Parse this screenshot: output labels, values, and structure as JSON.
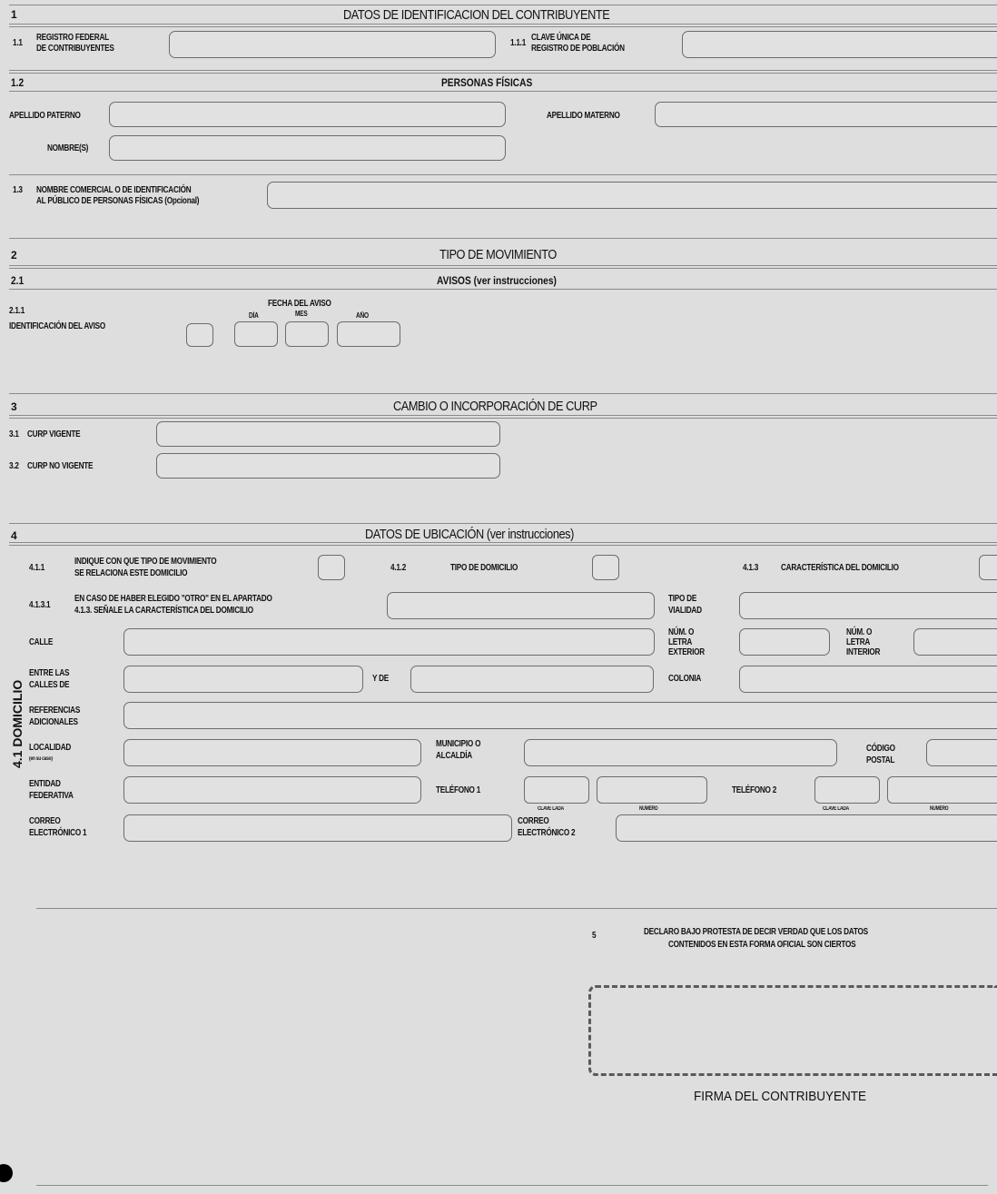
{
  "section1": {
    "num": "1",
    "title": "DATOS DE IDENTIFICACION DEL CONTRIBUYENTE",
    "f11_num": "1.1",
    "f11_label1": "REGISTRO FEDERAL",
    "f11_label2": "DE CONTRIBUYENTES",
    "f111_num": "1.1.1",
    "f111_label1": "CLAVE ÚNICA DE",
    "f111_label2": "REGISTRO DE POBLACIÓN"
  },
  "section12": {
    "num": "1.2",
    "title": "PERSONAS FÍSICAS",
    "apellido_paterno": "APELLIDO PATERNO",
    "apellido_materno": "APELLIDO MATERNO",
    "nombres": "NOMBRE(S)"
  },
  "section13": {
    "num": "1.3",
    "label1": "NOMBRE COMERCIAL O DE IDENTIFICACIÓN",
    "label2": "AL PÚBLICO DE PERSONAS FÍSICAS (Opcional)"
  },
  "section2": {
    "num": "2",
    "title": "TIPO DE MOVIMIENTO",
    "sub_num": "2.1",
    "sub_title": "AVISOS (ver instrucciones)",
    "f211_num": "2.1.1",
    "f211_label": "IDENTIFICACIÓN DEL AVISO",
    "fecha_label": "FECHA DEL AVISO",
    "dia": "DÍA",
    "mes": "MES",
    "anio": "AÑO"
  },
  "section3": {
    "num": "3",
    "title": "CAMBIO O INCORPORACIÓN DE CURP",
    "f31_num": "3.1",
    "f31_label": "CURP VIGENTE",
    "f32_num": "3.2",
    "f32_label": "CURP NO VIGENTE"
  },
  "section4": {
    "num": "4",
    "title": "DATOS DE UBICACIÓN (ver instrucciones)",
    "domicilio_label": "4.1 DOMICILIO",
    "f411_num": "4.1.1",
    "f411_label1": "INDIQUE CON QUE TIPO DE MOVIMIENTO",
    "f411_label2": "SE RELACIONA ESTE DOMICILIO",
    "f412_num": "4.1.2",
    "f412_label": "TIPO DE DOMICILIO",
    "f413_num": "4.1.3",
    "f413_label": "CARACTERÍSTICA DEL DOMICILIO",
    "f4131_num": "4.1.3.1",
    "f4131_label1": "EN CASO DE HABER ELEGIDO \"OTRO\" EN EL APARTADO",
    "f4131_label2": "4.1.3. SEÑALE LA CARACTERÍSTICA DEL DOMICILIO",
    "tipo_vialidad1": "TIPO DE",
    "tipo_vialidad2": "VIALIDAD",
    "calle": "CALLE",
    "num_ext1": "NÚM. O",
    "num_ext2": "LETRA",
    "num_ext3": "EXTERIOR",
    "num_int1": "NÚM. O",
    "num_int2": "LETRA",
    "num_int3": "INTERIOR",
    "entre1": "ENTRE LAS",
    "entre2": "CALLES DE",
    "y_de": "Y DE",
    "colonia": "COLONIA",
    "ref1": "REFERENCIAS",
    "ref2": "ADICIONALES",
    "localidad1": "LOCALIDAD",
    "localidad2": "(en su caso)",
    "municipio1": "MUNICIPIO O",
    "municipio2": "ALCALDÍA",
    "cp1": "CÓDIGO",
    "cp2": "POSTAL",
    "entidad1": "ENTIDAD",
    "entidad2": "FEDERATIVA",
    "telefono1": "TELÉFONO 1",
    "telefono2": "TELÉFONO 2",
    "clave_lada": "CLAVE LADA",
    "numero": "NÚMERO",
    "correo1_a": "CORREO",
    "correo1_b": "ELECTRÓNICO 1",
    "correo2_a": "CORREO",
    "correo2_b": "ELECTRÓNICO 2"
  },
  "section5": {
    "num": "5",
    "declaro1": "DECLARO BAJO PROTESTA DE DECIR VERDAD QUE LOS DATOS",
    "declaro2": "CONTENIDOS EN ESTA FORMA OFICIAL SON CIERTOS",
    "firma": "FIRMA DEL CONTRIBUYENTE"
  }
}
